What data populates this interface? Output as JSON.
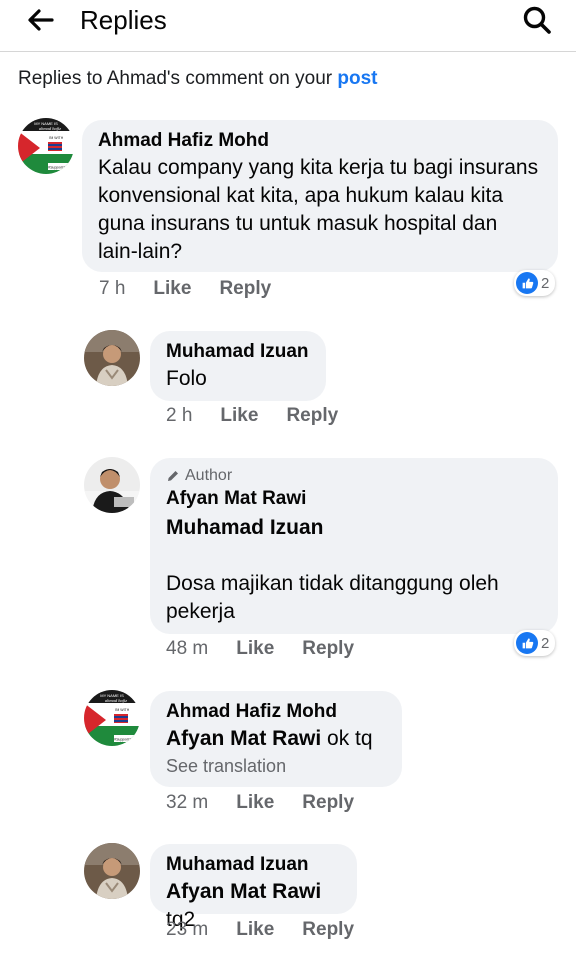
{
  "header": {
    "title": "Replies"
  },
  "context": {
    "prefix": "Replies to Ahmad's comment on your ",
    "link": "post"
  },
  "comments": [
    {
      "author": "Ahmad Hafiz Mohd",
      "text": "Kalau company yang kita kerja tu bagi insurans konvensional kat kita, apa hukum kalau kita guna insurans tu untuk masuk hospital dan lain-lain?",
      "time": "7 h",
      "like_label": "Like",
      "reply_label": "Reply",
      "reaction_count": "2",
      "avatar_icon": "palestine-flag-avatar"
    }
  ],
  "replies": [
    {
      "author": "Muhamad Izuan",
      "text": "Folo",
      "time": "2 h",
      "like_label": "Like",
      "reply_label": "Reply",
      "avatar_icon": "person-photo-avatar"
    },
    {
      "author_tag": "Author",
      "author": "Afyan Mat Rawi",
      "mention": "Muhamad Izuan",
      "text": "Dosa majikan tidak ditanggung oleh pekerja",
      "time": "48 m",
      "like_label": "Like",
      "reply_label": "Reply",
      "reaction_count": "2",
      "avatar_icon": "person-photo-avatar"
    },
    {
      "author": "Ahmad Hafiz Mohd",
      "mention": "Afyan Mat Rawi",
      "text": "ok tq",
      "see_translation": "See translation",
      "time": "32 m",
      "like_label": "Like",
      "reply_label": "Reply",
      "avatar_icon": "palestine-flag-avatar"
    },
    {
      "author": "Muhamad Izuan",
      "mention": "Afyan Mat Rawi",
      "text": "tq2",
      "time": "23 m",
      "like_label": "Like",
      "reply_label": "Reply",
      "avatar_icon": "person-photo-avatar"
    }
  ],
  "avatar_texts": {
    "top": "MY NAME IS",
    "script": "ahmad hafiz",
    "stand": "I'M WITH",
    "hashtag": "#SupportGAZA"
  },
  "colors": {
    "accent": "#1877f2",
    "bubble": "#f0f2f5",
    "meta": "#65676b"
  }
}
